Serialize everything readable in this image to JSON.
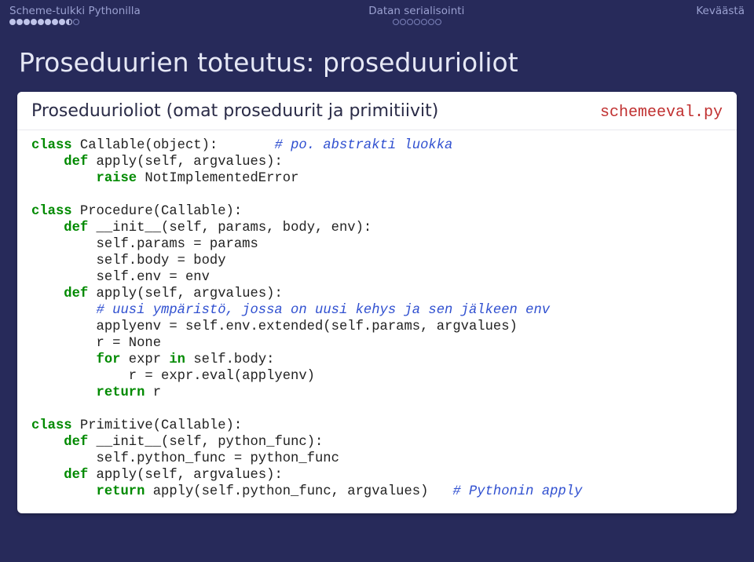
{
  "nav": {
    "left": "Scheme-tulkki Pythonilla",
    "mid": "Datan serialisointi",
    "right": "Keväästä"
  },
  "slide": {
    "title": "Proseduurien toteutus: proseduurioliot"
  },
  "card": {
    "title": "Proseduurioliot (omat proseduurit ja primitiivit)",
    "filename": "schemeeval.py"
  },
  "code": {
    "l1a": "class",
    "l1b": " Callable(object):       ",
    "l1c": "# po. abstrakti luokka",
    "l2a": "    ",
    "l2b": "def",
    "l2c": " apply(self, argvalues):",
    "l3a": "        ",
    "l3b": "raise",
    "l3c": " NotImplementedError",
    "blank1": "",
    "l4a": "class",
    "l4b": " Procedure(Callable):",
    "l5a": "    ",
    "l5b": "def",
    "l5c": " __init__(self, params, body, env):",
    "l6": "        self.params = params",
    "l7": "        self.body = body",
    "l8": "        self.env = env",
    "l9a": "    ",
    "l9b": "def",
    "l9c": " apply(self, argvalues):",
    "l10a": "        ",
    "l10b": "# uusi ympäristö, jossa on uusi kehys ja sen jälkeen env",
    "l11": "        applyenv = self.env.extended(self.params, argvalues)",
    "l12": "        r = None",
    "l13a": "        ",
    "l13b": "for",
    "l13c": " expr ",
    "l13d": "in",
    "l13e": " self.body:",
    "l14": "            r = expr.eval(applyenv)",
    "l15a": "        ",
    "l15b": "return",
    "l15c": " r",
    "blank2": "",
    "l16a": "class",
    "l16b": " Primitive(Callable):",
    "l17a": "    ",
    "l17b": "def",
    "l17c": " __init__(self, python_func):",
    "l18": "        self.python_func = python_func",
    "l19a": "    ",
    "l19b": "def",
    "l19c": " apply(self, argvalues):",
    "l20a": "        ",
    "l20b": "return",
    "l20c": " apply(self.python_func, argvalues)   ",
    "l20d": "# Pythonin apply"
  }
}
